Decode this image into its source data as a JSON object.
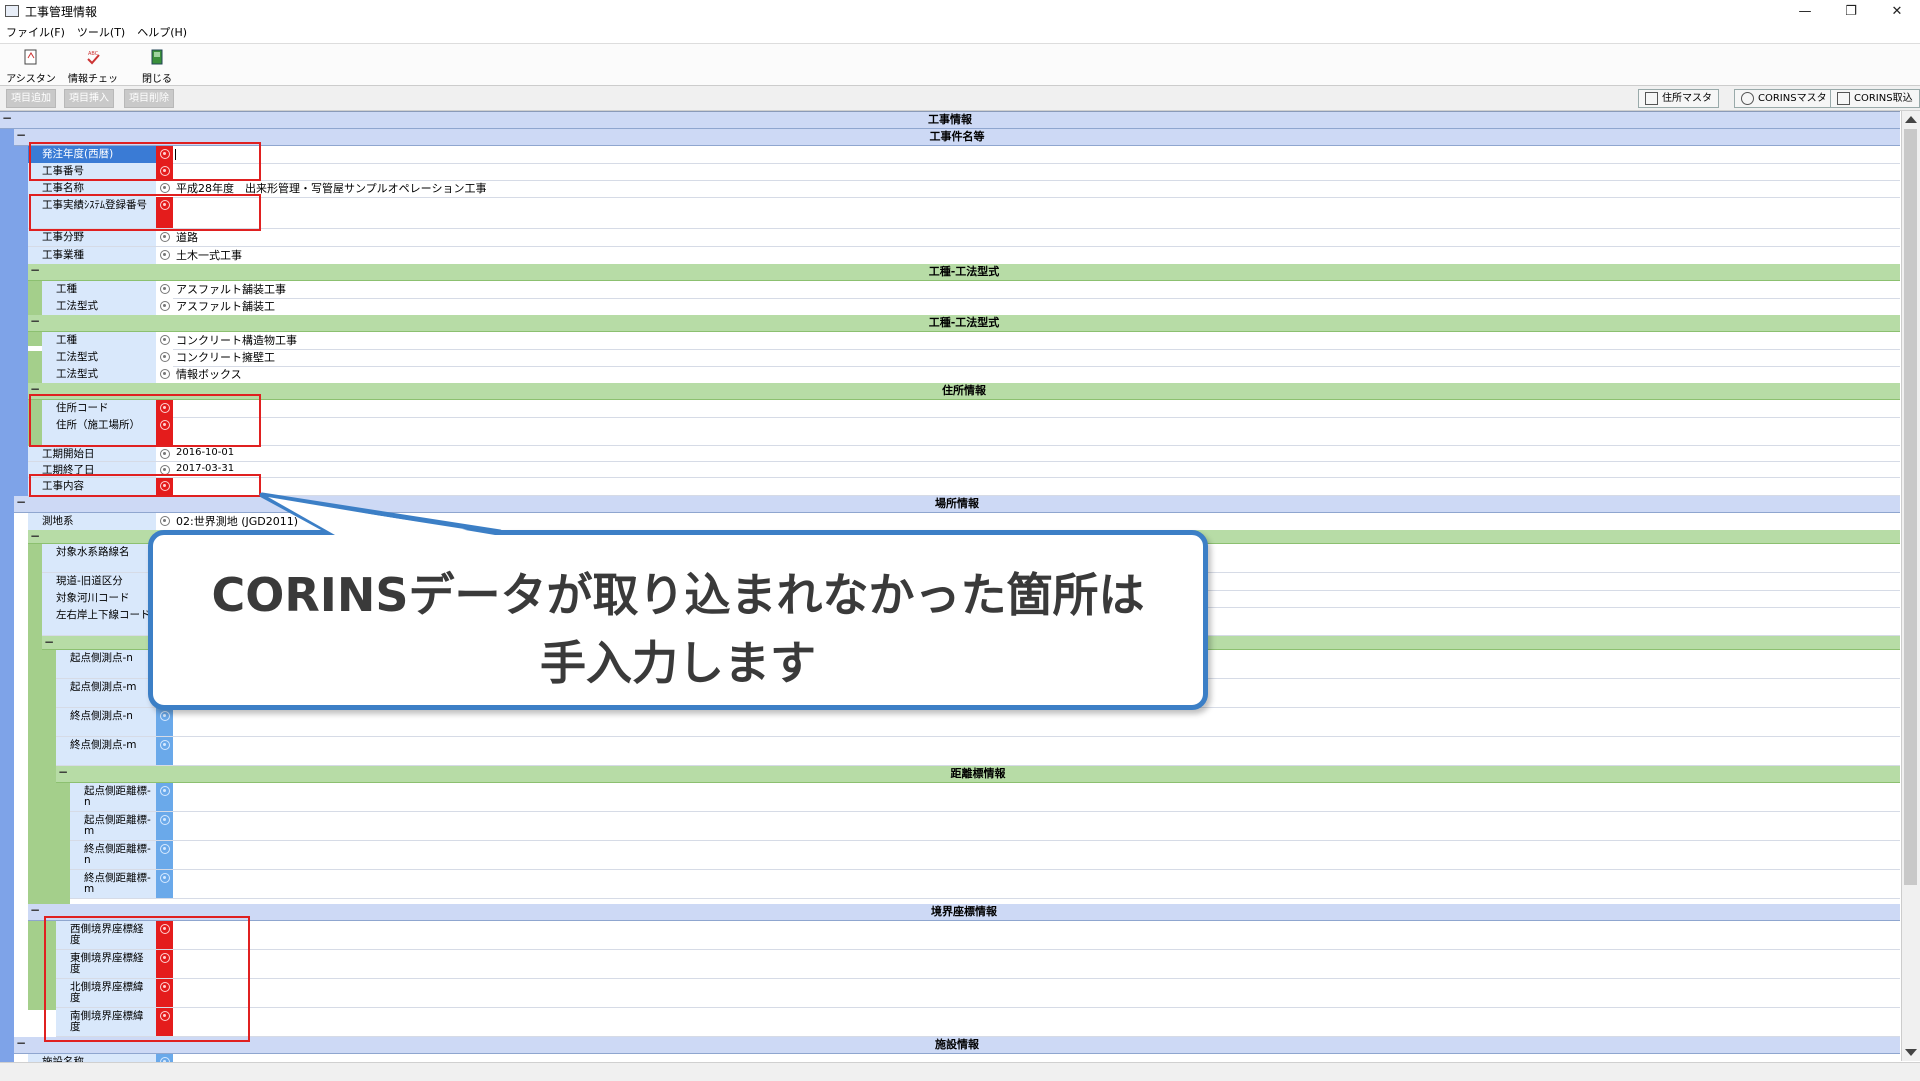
{
  "window": {
    "title": "工事管理情報",
    "controls": [
      "—",
      "❐",
      "✕"
    ]
  },
  "menu": [
    "ファイル(F)",
    "ツール(T)",
    "ヘルプ(H)"
  ],
  "toolbar": [
    {
      "label": "アシスタント",
      "icon": "assistant-icon"
    },
    {
      "label": "情報チェック",
      "icon": "check-icon"
    },
    {
      "label": "閉じる",
      "icon": "close-door-icon"
    }
  ],
  "subtoolbar": {
    "disabled": [
      "項目追加",
      "項目挿入",
      "項目削除"
    ],
    "right": [
      "住所マスタ",
      "CORINSマスタ",
      "CORINS取込"
    ]
  },
  "sections": {
    "koji_joho": "工事情報",
    "kenmei": "工事件名等",
    "koshu1": "工種-工法型式",
    "koshu2": "工種-工法型式",
    "jusho": "住所情報",
    "basho": "場所情報",
    "kyori": "距離標情報",
    "kyokai": "境界座標情報",
    "shisetsu": "施設情報"
  },
  "fields": {
    "hacchu_nendo": {
      "label": "発注年度(西暦)",
      "value": ""
    },
    "koji_bango": {
      "label": "工事番号",
      "value": ""
    },
    "koji_meisho": {
      "label": "工事名称",
      "value": "平成28年度　出来形管理・写管屋サンプルオペレーション工事"
    },
    "corins_no": {
      "label": "工事実績ｼｽﾃﾑ登録番号",
      "value": ""
    },
    "koji_bunya": {
      "label": "工事分野",
      "value": "道路"
    },
    "koji_gyoshu": {
      "label": "工事業種",
      "value": "土木一式工事"
    },
    "koshu_a": {
      "label": "工種",
      "value": "アスファルト舗装工事"
    },
    "koho_a": {
      "label": "工法型式",
      "value": "アスファルト舗装工"
    },
    "koshu_b": {
      "label": "工種",
      "value": "コンクリート構造物工事"
    },
    "koho_b1": {
      "label": "工法型式",
      "value": "コンクリート擁壁工"
    },
    "koho_b2": {
      "label": "工法型式",
      "value": "情報ボックス"
    },
    "jusho_code": {
      "label": "住所コード",
      "value": ""
    },
    "jusho": {
      "label": "住所（施工場所）",
      "value": ""
    },
    "kaishi": {
      "label": "工期開始日",
      "value": "2016-10-01"
    },
    "shuryo": {
      "label": "工期終了日",
      "value": "2017-03-31"
    },
    "naiyo": {
      "label": "工事内容",
      "value": ""
    },
    "sokuchi": {
      "label": "測地系",
      "value": "02:世界測地 (JGD2011)"
    },
    "suikei": {
      "label": "対象水系路線名",
      "value": ""
    },
    "gendo": {
      "label": "現道-旧道区分",
      "value": ""
    },
    "kasen": {
      "label": "対象河川コード",
      "value": ""
    },
    "sagan": {
      "label": "左右岸上下線コード",
      "value": ""
    },
    "kiten_n": {
      "label": "起点側測点-n",
      "value": ""
    },
    "kiten_m": {
      "label": "起点側測点-m",
      "value": ""
    },
    "shuten_n": {
      "label": "終点側測点-n",
      "value": ""
    },
    "shuten_m": {
      "label": "終点側測点-m",
      "value": ""
    },
    "kkyori_n": {
      "label": "起点側距離標-n",
      "value": ""
    },
    "kkyori_m": {
      "label": "起点側距離標-m",
      "value": ""
    },
    "skyori_n": {
      "label": "終点側距離標-n",
      "value": ""
    },
    "skyori_m": {
      "label": "終点側距離標-m",
      "value": ""
    },
    "west": {
      "label": "西側境界座標経度",
      "value": ""
    },
    "east": {
      "label": "東側境界座標経度",
      "value": ""
    },
    "north": {
      "label": "北側境界座標緯度",
      "value": ""
    },
    "south": {
      "label": "南側境界座標緯度",
      "value": ""
    },
    "shisetsu_meisho": {
      "label": "施設名称",
      "value": ""
    }
  },
  "callout": {
    "line1": "CORINSデータが取り込まれなかった箇所は",
    "line2": "手入力します"
  },
  "colors": {
    "required_marker": "#e41c1c",
    "highlight_box": "#e02020",
    "callout_border": "#3c7fc6",
    "section_blue": "#cdd9f5",
    "section_green": "#b7dca6"
  }
}
